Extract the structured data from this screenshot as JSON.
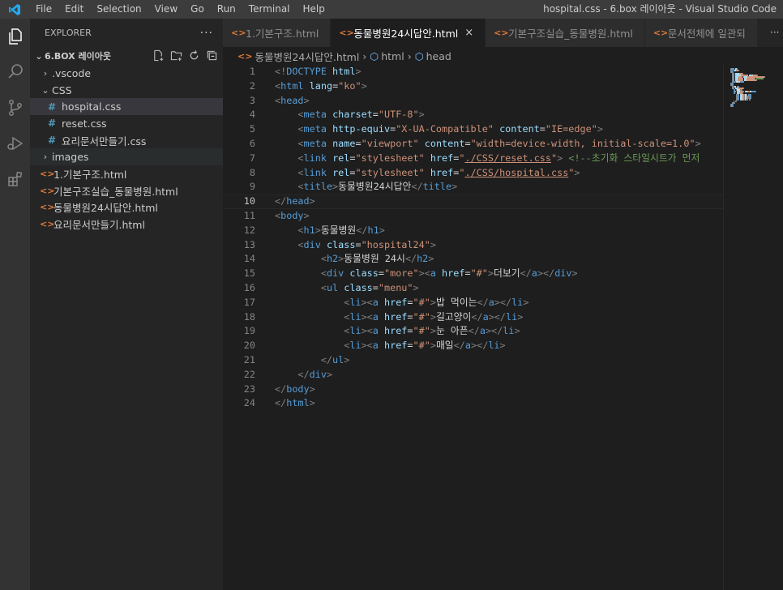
{
  "window": {
    "title": "hospital.css - 6.box 레이아웃 - Visual Studio Code",
    "menu": [
      "File",
      "Edit",
      "Selection",
      "View",
      "Go",
      "Run",
      "Terminal",
      "Help"
    ]
  },
  "activity_bar": {
    "icons": [
      "explorer-icon",
      "search-icon",
      "source-control-icon",
      "run-debug-icon",
      "extensions-icon"
    ]
  },
  "explorer": {
    "header": "EXPLORER",
    "more": "···",
    "root_folder": "6.BOX 레이아웃",
    "tree": [
      {
        "type": "folder",
        "name": ".vscode",
        "indent": 1,
        "expanded": false
      },
      {
        "type": "folder",
        "name": "CSS",
        "indent": 1,
        "expanded": true
      },
      {
        "type": "css",
        "name": "hospital.css",
        "indent": 2,
        "selected": true
      },
      {
        "type": "css",
        "name": "reset.css",
        "indent": 2
      },
      {
        "type": "css",
        "name": "요리문서만들기.css",
        "indent": 2
      },
      {
        "type": "folder",
        "name": "images",
        "indent": 1,
        "expanded": false,
        "hover": true
      },
      {
        "type": "html",
        "name": "1.기본구조.html",
        "indent": 1
      },
      {
        "type": "html",
        "name": "기본구조실습_동물병원.html",
        "indent": 1
      },
      {
        "type": "html",
        "name": "동물병원24시답안.html",
        "indent": 1
      },
      {
        "type": "html",
        "name": "요리문서만들기.html",
        "indent": 1
      }
    ]
  },
  "tabs": [
    {
      "label": "1.기본구조.html",
      "active": false
    },
    {
      "label": "동물병원24시답안.html",
      "active": true,
      "close": "×"
    },
    {
      "label": "기본구조실습_동물병원.html",
      "active": false
    },
    {
      "label": "문서전체에 일관되",
      "active": false
    }
  ],
  "tabs_more": "···",
  "breadcrumb": {
    "file": "동물병원24시답안.html",
    "items": [
      "html",
      "head"
    ]
  },
  "editor": {
    "current_line": 10,
    "lines": [
      [
        [
          "br",
          "<!"
        ],
        [
          "tag",
          "DOCTYPE"
        ],
        [
          "txt",
          " "
        ],
        [
          "attr",
          "html"
        ],
        [
          "br",
          ">"
        ]
      ],
      [
        [
          "br",
          "<"
        ],
        [
          "tag",
          "html"
        ],
        [
          "txt",
          " "
        ],
        [
          "attr",
          "lang"
        ],
        [
          "txt",
          "="
        ],
        [
          "str",
          "\"ko\""
        ],
        [
          "br",
          ">"
        ]
      ],
      [
        [
          "br",
          "<"
        ],
        [
          "tag",
          "head"
        ],
        [
          "br",
          ">"
        ]
      ],
      [
        [
          "ind",
          "    "
        ],
        [
          "br",
          "<"
        ],
        [
          "tag",
          "meta"
        ],
        [
          "txt",
          " "
        ],
        [
          "attr",
          "charset"
        ],
        [
          "txt",
          "="
        ],
        [
          "str",
          "\"UTF-8\""
        ],
        [
          "br",
          ">"
        ]
      ],
      [
        [
          "ind",
          "    "
        ],
        [
          "br",
          "<"
        ],
        [
          "tag",
          "meta"
        ],
        [
          "txt",
          " "
        ],
        [
          "attr",
          "http-equiv"
        ],
        [
          "txt",
          "="
        ],
        [
          "str",
          "\"X-UA-Compatible\""
        ],
        [
          "txt",
          " "
        ],
        [
          "attr",
          "content"
        ],
        [
          "txt",
          "="
        ],
        [
          "str",
          "\"IE=edge\""
        ],
        [
          "br",
          ">"
        ]
      ],
      [
        [
          "ind",
          "    "
        ],
        [
          "br",
          "<"
        ],
        [
          "tag",
          "meta"
        ],
        [
          "txt",
          " "
        ],
        [
          "attr",
          "name"
        ],
        [
          "txt",
          "="
        ],
        [
          "str",
          "\"viewport\""
        ],
        [
          "txt",
          " "
        ],
        [
          "attr",
          "content"
        ],
        [
          "txt",
          "="
        ],
        [
          "str",
          "\"width=device-width, initial-scale=1.0\""
        ],
        [
          "br",
          ">"
        ]
      ],
      [
        [
          "ind",
          "    "
        ],
        [
          "br",
          "<"
        ],
        [
          "tag",
          "link"
        ],
        [
          "txt",
          " "
        ],
        [
          "attr",
          "rel"
        ],
        [
          "txt",
          "="
        ],
        [
          "str",
          "\"stylesheet\""
        ],
        [
          "txt",
          " "
        ],
        [
          "attr",
          "href"
        ],
        [
          "txt",
          "="
        ],
        [
          "str",
          "\""
        ],
        [
          "stru",
          "./CSS/reset.css"
        ],
        [
          "str",
          "\""
        ],
        [
          "br",
          ">"
        ],
        [
          "txt",
          " "
        ],
        [
          "com",
          "<!--초기화 스타일시트가 먼저"
        ]
      ],
      [
        [
          "ind",
          "    "
        ],
        [
          "br",
          "<"
        ],
        [
          "tag",
          "link"
        ],
        [
          "txt",
          " "
        ],
        [
          "attr",
          "rel"
        ],
        [
          "txt",
          "="
        ],
        [
          "str",
          "\"stylesheet\""
        ],
        [
          "txt",
          " "
        ],
        [
          "attr",
          "href"
        ],
        [
          "txt",
          "="
        ],
        [
          "str",
          "\""
        ],
        [
          "stru",
          "./CSS/hospital.css"
        ],
        [
          "str",
          "\""
        ],
        [
          "br",
          ">"
        ]
      ],
      [
        [
          "ind",
          "    "
        ],
        [
          "br",
          "<"
        ],
        [
          "tag",
          "title"
        ],
        [
          "br",
          ">"
        ],
        [
          "txt",
          "동물병원24시답안"
        ],
        [
          "br",
          "</"
        ],
        [
          "tag",
          "title"
        ],
        [
          "br",
          ">"
        ]
      ],
      [
        [
          "br",
          "</"
        ],
        [
          "tag",
          "head"
        ],
        [
          "br",
          ">"
        ]
      ],
      [
        [
          "br",
          "<"
        ],
        [
          "tag",
          "body"
        ],
        [
          "br",
          ">"
        ]
      ],
      [
        [
          "ind",
          "    "
        ],
        [
          "br",
          "<"
        ],
        [
          "tag",
          "h1"
        ],
        [
          "br",
          ">"
        ],
        [
          "txt",
          "동물병원"
        ],
        [
          "br",
          "</"
        ],
        [
          "tag",
          "h1"
        ],
        [
          "br",
          ">"
        ]
      ],
      [
        [
          "ind",
          "    "
        ],
        [
          "br",
          "<"
        ],
        [
          "tag",
          "div"
        ],
        [
          "txt",
          " "
        ],
        [
          "attr",
          "class"
        ],
        [
          "txt",
          "="
        ],
        [
          "str",
          "\"hospital24\""
        ],
        [
          "br",
          ">"
        ]
      ],
      [
        [
          "ind",
          "        "
        ],
        [
          "br",
          "<"
        ],
        [
          "tag",
          "h2"
        ],
        [
          "br",
          ">"
        ],
        [
          "txt",
          "동물병원 24시"
        ],
        [
          "br",
          "</"
        ],
        [
          "tag",
          "h2"
        ],
        [
          "br",
          ">"
        ]
      ],
      [
        [
          "ind",
          "        "
        ],
        [
          "br",
          "<"
        ],
        [
          "tag",
          "div"
        ],
        [
          "txt",
          " "
        ],
        [
          "attr",
          "class"
        ],
        [
          "txt",
          "="
        ],
        [
          "str",
          "\"more\""
        ],
        [
          "br",
          "><"
        ],
        [
          "tag",
          "a"
        ],
        [
          "txt",
          " "
        ],
        [
          "attr",
          "href"
        ],
        [
          "txt",
          "="
        ],
        [
          "str",
          "\"#\""
        ],
        [
          "br",
          ">"
        ],
        [
          "txt",
          "더보기"
        ],
        [
          "br",
          "</"
        ],
        [
          "tag",
          "a"
        ],
        [
          "br",
          "></"
        ],
        [
          "tag",
          "div"
        ],
        [
          "br",
          ">"
        ]
      ],
      [
        [
          "ind",
          "        "
        ],
        [
          "br",
          "<"
        ],
        [
          "tag",
          "ul"
        ],
        [
          "txt",
          " "
        ],
        [
          "attr",
          "class"
        ],
        [
          "txt",
          "="
        ],
        [
          "str",
          "\"menu\""
        ],
        [
          "br",
          ">"
        ]
      ],
      [
        [
          "ind",
          "            "
        ],
        [
          "br",
          "<"
        ],
        [
          "tag",
          "li"
        ],
        [
          "br",
          "><"
        ],
        [
          "tag",
          "a"
        ],
        [
          "txt",
          " "
        ],
        [
          "attr",
          "href"
        ],
        [
          "txt",
          "="
        ],
        [
          "str",
          "\"#\""
        ],
        [
          "br",
          ">"
        ],
        [
          "txt",
          "밥 먹이는"
        ],
        [
          "br",
          "</"
        ],
        [
          "tag",
          "a"
        ],
        [
          "br",
          "></"
        ],
        [
          "tag",
          "li"
        ],
        [
          "br",
          ">"
        ]
      ],
      [
        [
          "ind",
          "            "
        ],
        [
          "br",
          "<"
        ],
        [
          "tag",
          "li"
        ],
        [
          "br",
          "><"
        ],
        [
          "tag",
          "a"
        ],
        [
          "txt",
          " "
        ],
        [
          "attr",
          "href"
        ],
        [
          "txt",
          "="
        ],
        [
          "str",
          "\"#\""
        ],
        [
          "br",
          ">"
        ],
        [
          "txt",
          "길고양이"
        ],
        [
          "br",
          "</"
        ],
        [
          "tag",
          "a"
        ],
        [
          "br",
          "></"
        ],
        [
          "tag",
          "li"
        ],
        [
          "br",
          ">"
        ]
      ],
      [
        [
          "ind",
          "            "
        ],
        [
          "br",
          "<"
        ],
        [
          "tag",
          "li"
        ],
        [
          "br",
          "><"
        ],
        [
          "tag",
          "a"
        ],
        [
          "txt",
          " "
        ],
        [
          "attr",
          "href"
        ],
        [
          "txt",
          "="
        ],
        [
          "str",
          "\"#\""
        ],
        [
          "br",
          ">"
        ],
        [
          "txt",
          "눈 아픈"
        ],
        [
          "br",
          "</"
        ],
        [
          "tag",
          "a"
        ],
        [
          "br",
          "></"
        ],
        [
          "tag",
          "li"
        ],
        [
          "br",
          ">"
        ]
      ],
      [
        [
          "ind",
          "            "
        ],
        [
          "br",
          "<"
        ],
        [
          "tag",
          "li"
        ],
        [
          "br",
          "><"
        ],
        [
          "tag",
          "a"
        ],
        [
          "txt",
          " "
        ],
        [
          "attr",
          "href"
        ],
        [
          "txt",
          "="
        ],
        [
          "str",
          "\"#\""
        ],
        [
          "br",
          ">"
        ],
        [
          "txt",
          "매일"
        ],
        [
          "br",
          "</"
        ],
        [
          "tag",
          "a"
        ],
        [
          "br",
          "></"
        ],
        [
          "tag",
          "li"
        ],
        [
          "br",
          ">"
        ]
      ],
      [
        [
          "ind",
          "        "
        ],
        [
          "br",
          "</"
        ],
        [
          "tag",
          "ul"
        ],
        [
          "br",
          ">"
        ]
      ],
      [
        [
          "ind",
          "    "
        ],
        [
          "br",
          "</"
        ],
        [
          "tag",
          "div"
        ],
        [
          "br",
          ">"
        ]
      ],
      [
        [
          "br",
          "</"
        ],
        [
          "tag",
          "body"
        ],
        [
          "br",
          ">"
        ]
      ],
      [
        [
          "br",
          "</"
        ],
        [
          "tag",
          "html"
        ],
        [
          "br",
          ">"
        ]
      ]
    ]
  },
  "colors": {
    "tag": "#569cd6",
    "attr": "#9cdcfe",
    "string": "#ce9178",
    "bracket": "#808080",
    "text": "#d4d4d4",
    "comment": "#6a9955"
  }
}
